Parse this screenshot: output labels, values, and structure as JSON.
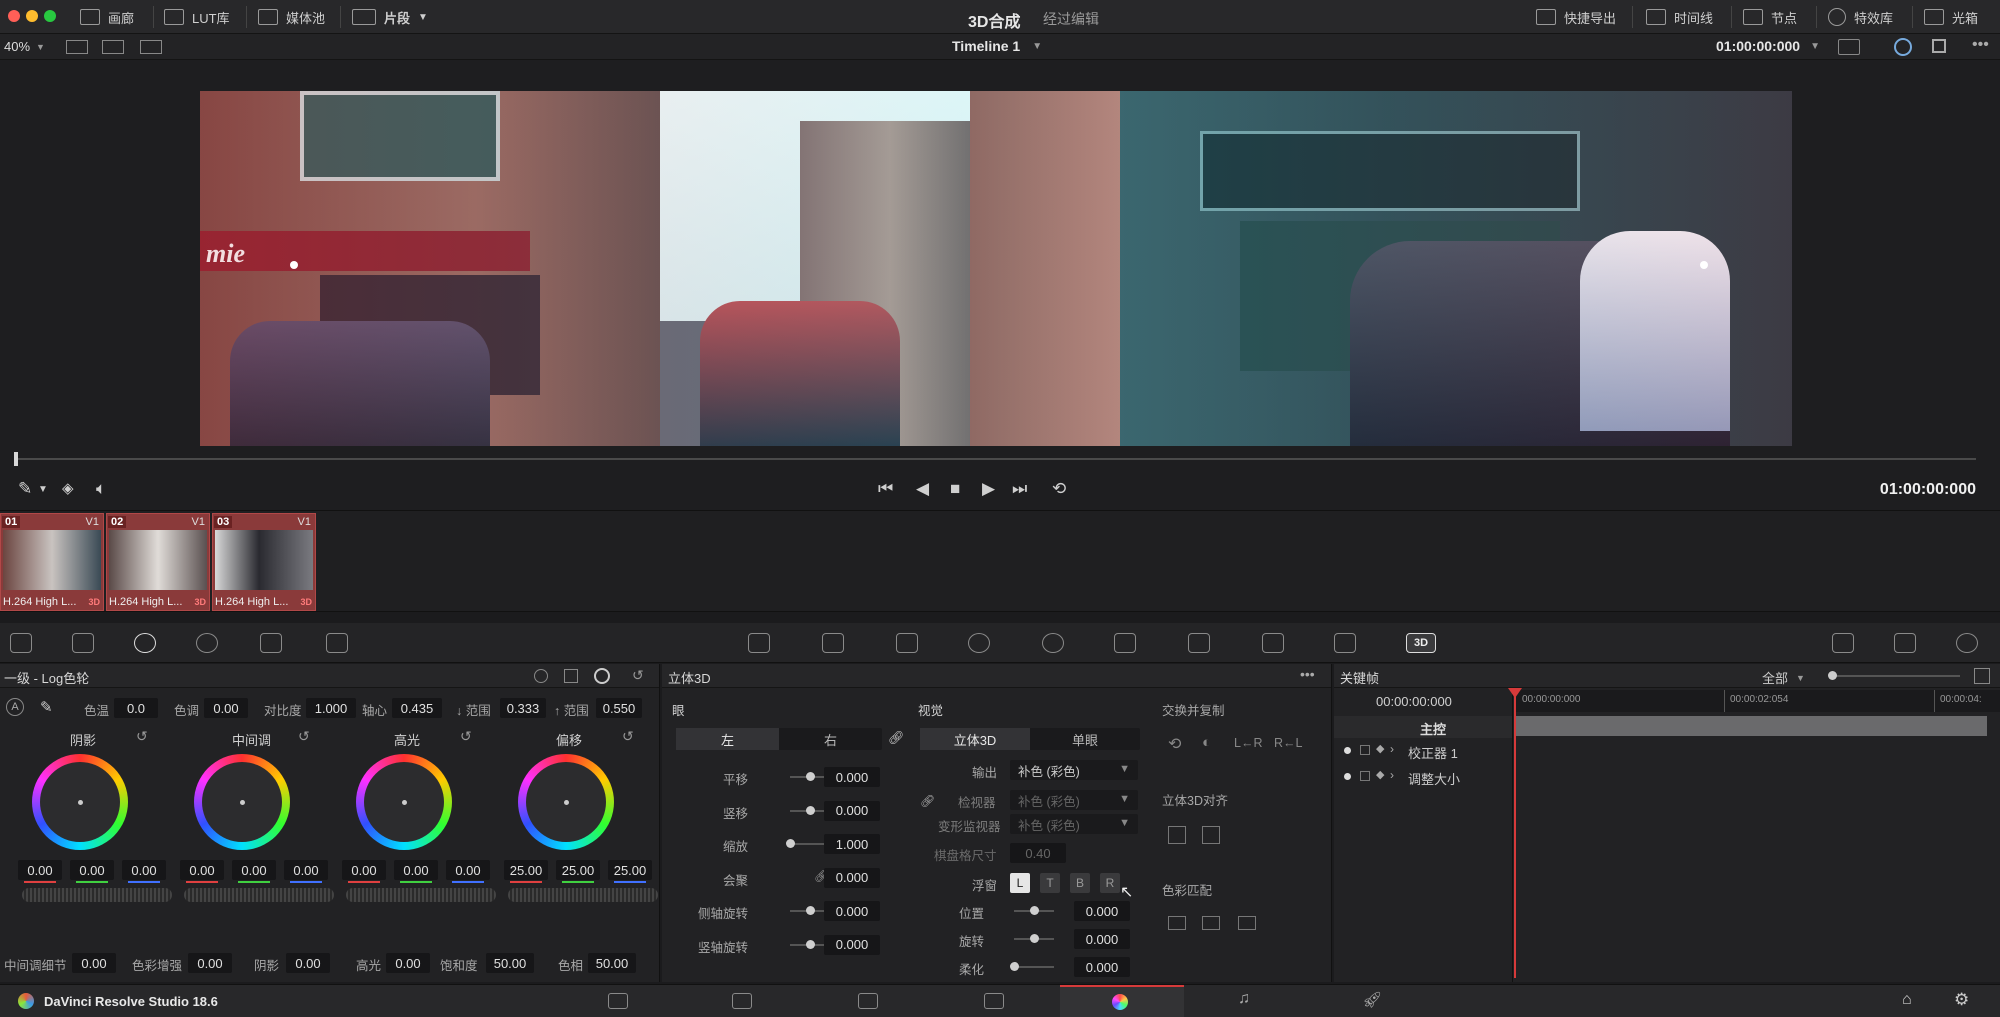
{
  "topbar": {
    "left_items": [
      {
        "label": "画廊",
        "icon": "gallery-icon"
      },
      {
        "label": "LUT库",
        "icon": "lut-icon"
      },
      {
        "label": "媒体池",
        "icon": "media-pool-icon"
      },
      {
        "label": "片段",
        "icon": "clips-icon"
      }
    ],
    "title": "3D合成",
    "subtitle": "经过编辑",
    "right_items": [
      {
        "label": "快捷导出",
        "icon": "export-icon"
      },
      {
        "label": "时间线",
        "icon": "timeline-icon"
      },
      {
        "label": "节点",
        "icon": "nodes-icon"
      },
      {
        "label": "特效库",
        "icon": "fx-icon"
      },
      {
        "label": "光箱",
        "icon": "lightbox-icon"
      }
    ]
  },
  "viewer": {
    "zoom": "40%",
    "timeline_name": "Timeline 1",
    "timecode": "01:00:00:000",
    "transport_timecode": "01:00:00:000"
  },
  "clips": [
    {
      "num": "01",
      "track": "V1",
      "label": "H.264 High L...",
      "badge": "3D"
    },
    {
      "num": "02",
      "track": "V1",
      "label": "H.264 High L...",
      "badge": "3D"
    },
    {
      "num": "03",
      "track": "V1",
      "label": "H.264 High L...",
      "badge": "3D"
    }
  ],
  "color_wheels": {
    "title": "一级 - Log色轮",
    "top_params": [
      {
        "label": "色温",
        "value": "0.0"
      },
      {
        "label": "色调",
        "value": "0.00"
      },
      {
        "label": "对比度",
        "value": "1.000"
      },
      {
        "label": "轴心",
        "value": "0.435"
      },
      {
        "label": "↓ 范围",
        "value": "0.333"
      },
      {
        "label": "↑ 范围",
        "value": "0.550"
      }
    ],
    "wheels": [
      {
        "name": "阴影",
        "values": [
          "0.00",
          "0.00",
          "0.00"
        ]
      },
      {
        "name": "中间调",
        "values": [
          "0.00",
          "0.00",
          "0.00"
        ]
      },
      {
        "name": "高光",
        "values": [
          "0.00",
          "0.00",
          "0.00"
        ]
      },
      {
        "name": "偏移",
        "values": [
          "25.00",
          "25.00",
          "25.00"
        ]
      }
    ],
    "bottom_params": [
      {
        "label": "中间调细节",
        "value": "0.00"
      },
      {
        "label": "色彩增强",
        "value": "0.00"
      },
      {
        "label": "阴影",
        "value": "0.00"
      },
      {
        "label": "高光",
        "value": "0.00"
      },
      {
        "label": "饱和度",
        "value": "50.00"
      },
      {
        "label": "色相",
        "value": "50.00"
      }
    ]
  },
  "stereo3d": {
    "title": "立体3D",
    "eye_section": "眼",
    "eye_tabs": [
      "左",
      "右"
    ],
    "eye_params": [
      {
        "label": "平移",
        "value": "0.000",
        "knob": 0.5
      },
      {
        "label": "竖移",
        "value": "0.000",
        "knob": 0.5
      },
      {
        "label": "缩放",
        "value": "1.000",
        "knob": 0.0
      },
      {
        "label": "会聚",
        "value": "0.000"
      },
      {
        "label": "侧轴旋转",
        "value": "0.000",
        "knob": 0.5
      },
      {
        "label": "竖轴旋转",
        "value": "0.000",
        "knob": 0.5
      }
    ],
    "vision_section": "视觉",
    "vision_tabs": [
      "立体3D",
      "单眼"
    ],
    "output_label": "输出",
    "output_value": "补色 (彩色)",
    "viewer_label": "检视器",
    "viewer_value": "补色 (彩色)",
    "monitor_label": "变形监视器",
    "monitor_value": "补色 (彩色)",
    "checker_label": "棋盘格尺寸",
    "checker_value": "0.40",
    "float_label": "浮窗",
    "float_buttons": [
      "L",
      "T",
      "B",
      "R"
    ],
    "vision_params": [
      {
        "label": "位置",
        "value": "0.000",
        "knob": 0.5
      },
      {
        "label": "旋转",
        "value": "0.000",
        "knob": 0.5
      },
      {
        "label": "柔化",
        "value": "0.000",
        "knob": 0.0
      }
    ],
    "swap_section": "交换并复制",
    "swap_buttons": [
      "L←R",
      "R←L"
    ],
    "align_section": "立体3D对齐",
    "match_section": "色彩匹配"
  },
  "keyframes": {
    "title": "关键帧",
    "filter": "全部",
    "current_time": "00:00:00:000",
    "ruler_marks": [
      "00:00:00:000",
      "00:00:02:054",
      "00:00:04:"
    ],
    "tracks": [
      {
        "label": "主控"
      },
      {
        "label": "校正器 1"
      },
      {
        "label": "调整大小"
      }
    ]
  },
  "bottombar": {
    "app_name": "DaVinci Resolve Studio 18.6"
  },
  "colors": {
    "accent_red": "#d63a3a",
    "clip_bg": "#8a3a3a"
  }
}
